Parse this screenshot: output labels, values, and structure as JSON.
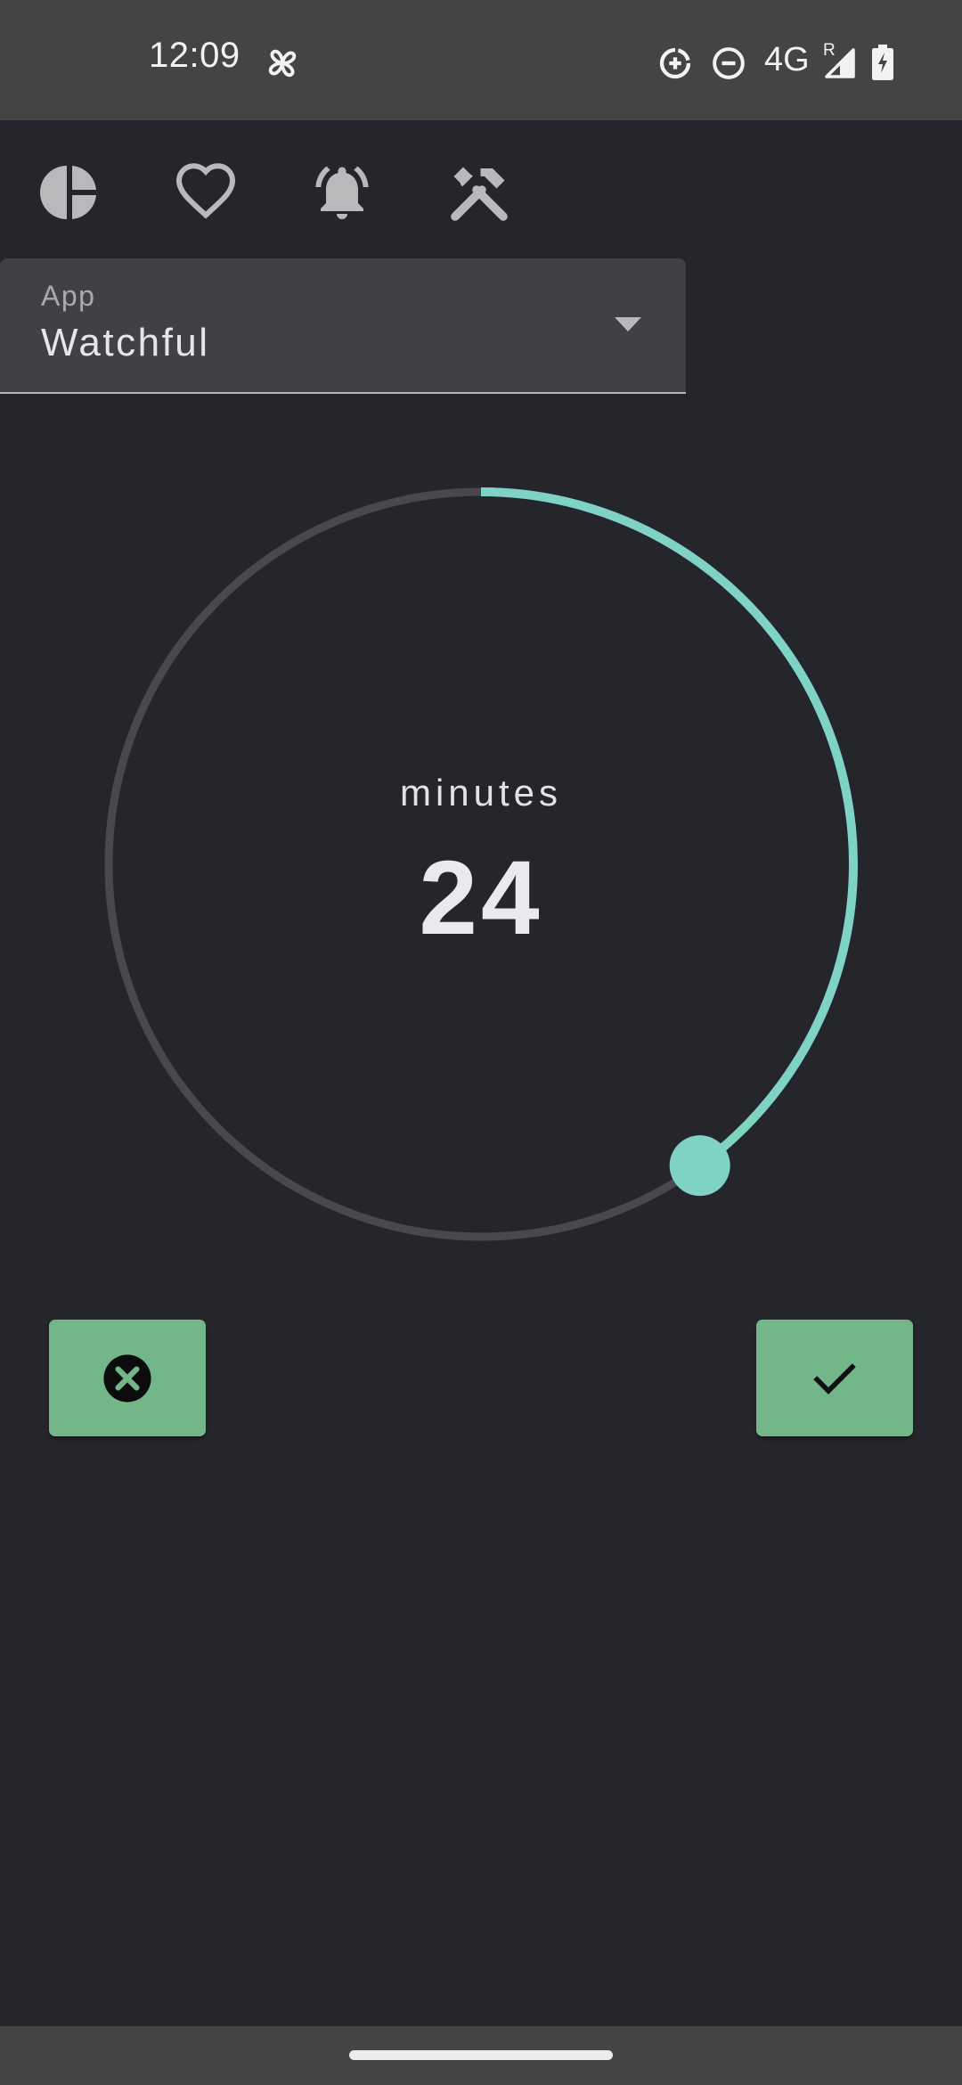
{
  "status_bar": {
    "time": "12:09",
    "network_type": "4G",
    "roaming_indicator": "R",
    "icons": [
      "fan-icon",
      "data-saver-icon",
      "do-not-disturb-icon",
      "signal-icon",
      "battery-charging-icon"
    ]
  },
  "nav": {
    "items": [
      {
        "icon": "pie-chart-icon"
      },
      {
        "icon": "heart-icon"
      },
      {
        "icon": "bell-icon"
      },
      {
        "icon": "tools-icon"
      }
    ]
  },
  "app_select": {
    "label": "App",
    "value": "Watchful"
  },
  "timer": {
    "unit_label": "minutes",
    "value": "24",
    "minutes": 24,
    "max_minutes": 60,
    "track_color": "#48494e",
    "progress_color": "#7fd3c4"
  },
  "actions": {
    "cancel_icon": "close-circle-icon",
    "confirm_icon": "check-icon",
    "button_color": "#72b68a"
  }
}
